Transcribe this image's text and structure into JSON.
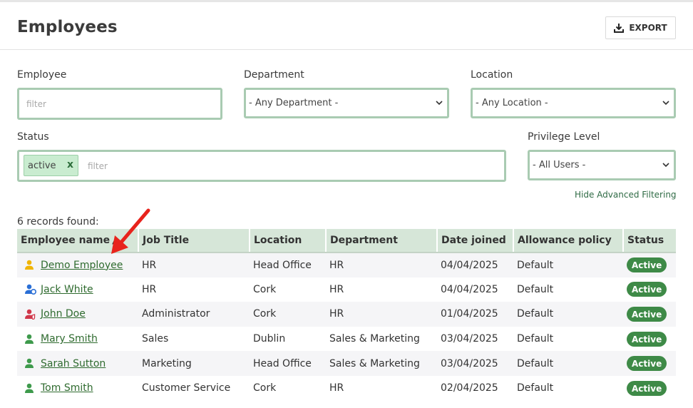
{
  "header": {
    "title": "Employees",
    "export_label": "EXPORT"
  },
  "filters": {
    "employee": {
      "label": "Employee",
      "placeholder": "filter"
    },
    "department": {
      "label": "Department",
      "value": "- Any Department -"
    },
    "location": {
      "label": "Location",
      "value": "- Any Location -"
    },
    "status": {
      "label": "Status",
      "tag": "active",
      "tag_remove": "x",
      "placeholder": "filter"
    },
    "privilege": {
      "label": "Privilege Level",
      "value": "- All Users -"
    },
    "hide_advanced": "Hide Advanced Filtering"
  },
  "records_found": "6 records found:",
  "table": {
    "columns": [
      "Employee name",
      "Job Title",
      "Location",
      "Department",
      "Date joined",
      "Allowance policy",
      "Status"
    ],
    "sort_indicator": "▲",
    "rows": [
      {
        "name": "Demo Employee",
        "icon": "admin-user-icon",
        "icon_color": "#f0b400",
        "job": "HR",
        "location": "Head Office",
        "department": "HR",
        "date": "04/04/2025",
        "policy": "Default",
        "status": "Active"
      },
      {
        "name": "Jack White",
        "icon": "manager-user-icon",
        "icon_color": "#2a6fd6",
        "job": "HR",
        "location": "Cork",
        "department": "HR",
        "date": "04/04/2025",
        "policy": "Default",
        "status": "Active"
      },
      {
        "name": "John Doe",
        "icon": "admin-user-icon",
        "icon_color": "#d0374a",
        "job": "Administrator",
        "location": "Cork",
        "department": "HR",
        "date": "01/04/2025",
        "policy": "Default",
        "status": "Active"
      },
      {
        "name": "Mary Smith",
        "icon": "user-icon",
        "icon_color": "#3e9a4c",
        "job": "Sales",
        "location": "Dublin",
        "department": "Sales & Marketing",
        "date": "03/04/2025",
        "policy": "Default",
        "status": "Active"
      },
      {
        "name": "Sarah Sutton",
        "icon": "user-icon",
        "icon_color": "#3e9a4c",
        "job": "Marketing",
        "location": "Head Office",
        "department": "Sales & Marketing",
        "date": "03/04/2025",
        "policy": "Default",
        "status": "Active"
      },
      {
        "name": "Tom Smith",
        "icon": "user-icon",
        "icon_color": "#3e9a4c",
        "job": "Customer Service",
        "location": "Cork",
        "department": "HR",
        "date": "02/04/2025",
        "policy": "Default",
        "status": "Active"
      }
    ]
  },
  "colors": {
    "accent_green": "#3e8a47",
    "filter_border": "#a9cbb2",
    "header_bg": "#d6e6d8",
    "annotation_arrow": "#e8231c"
  }
}
